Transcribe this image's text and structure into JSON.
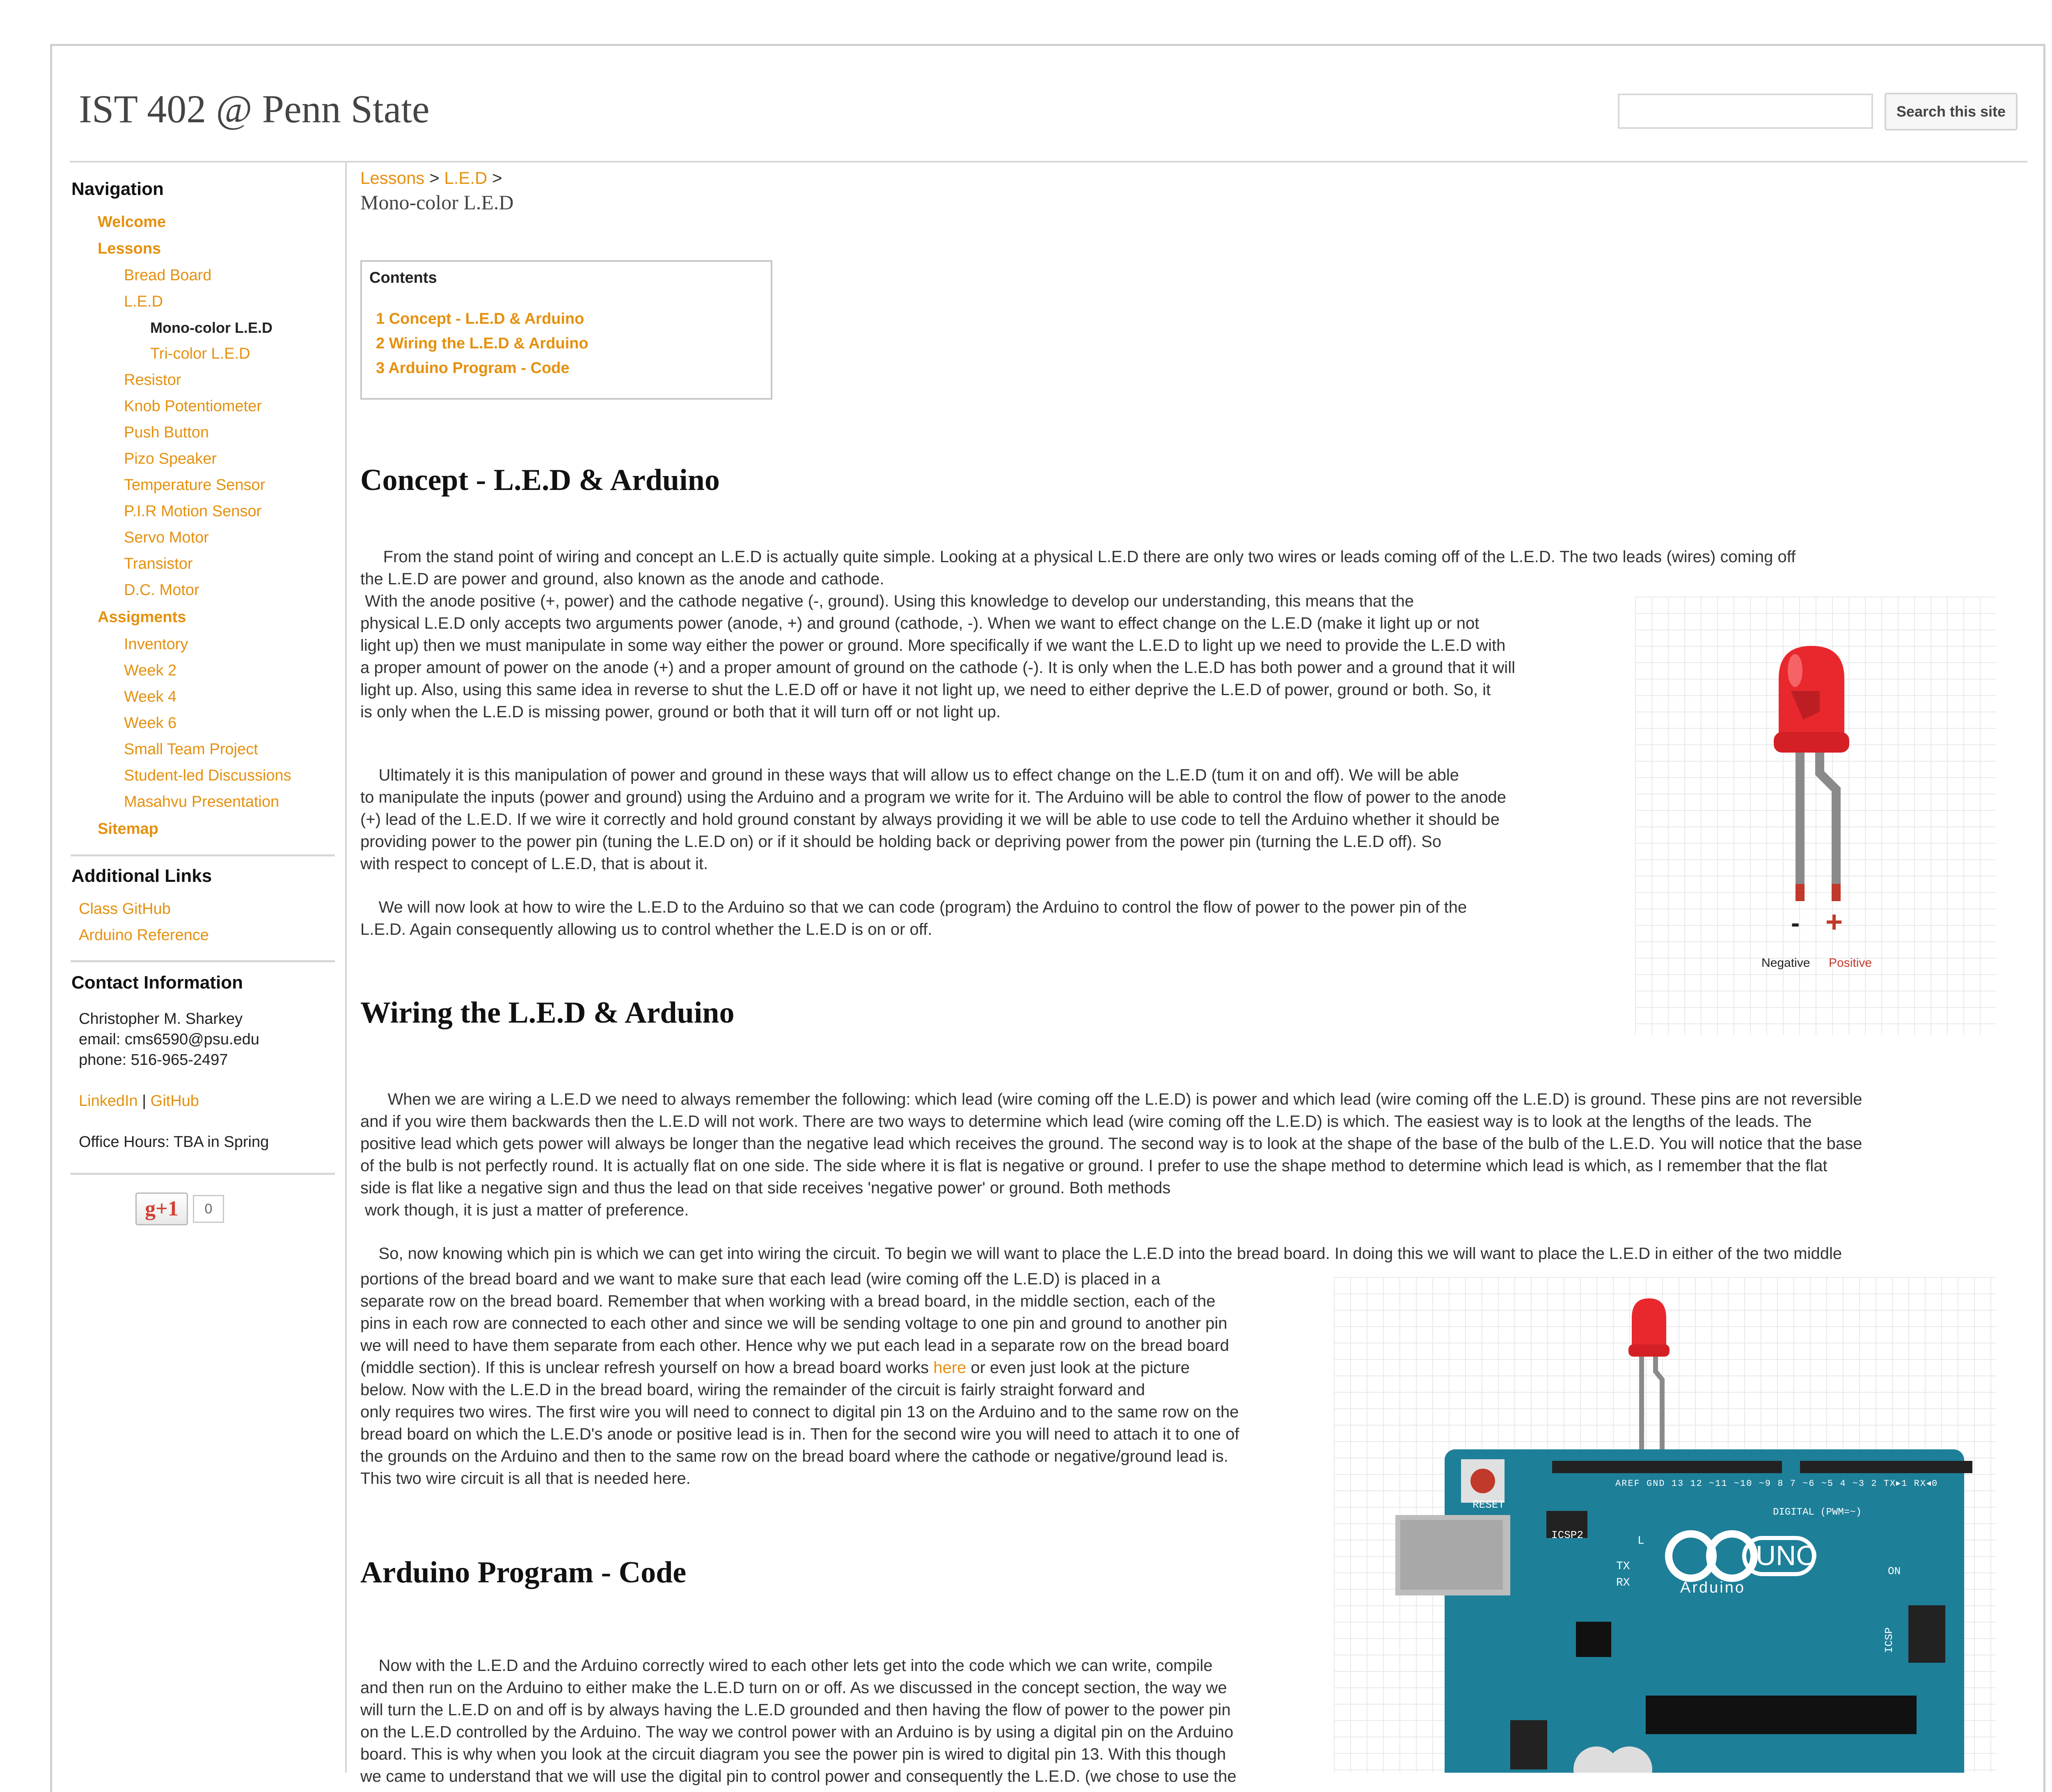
{
  "header": {
    "site_title": "IST 402 @ Penn State",
    "search_button": "Search this site",
    "search_placeholder": ""
  },
  "sidebar": {
    "nav_heading": "Navigation",
    "nav": {
      "welcome": "Welcome",
      "lessons": "Lessons",
      "bread_board": "Bread Board",
      "led": "L.E.D",
      "mono_led": "Mono-color L.E.D",
      "tri_led": "Tri-color L.E.D",
      "resistor": "Resistor",
      "knob": "Knob Potentiometer",
      "push_button": "Push Button",
      "pizo": "Pizo Speaker",
      "temp": "Temperature Sensor",
      "pir": "P.I.R Motion Sensor",
      "servo": "Servo Motor",
      "transistor": "Transistor",
      "dc_motor": "D.C. Motor",
      "assigments": "Assigments",
      "inventory": "Inventory",
      "week2": "Week 2",
      "week4": "Week 4",
      "week6": "Week 6",
      "small_team": "Small Team Project",
      "student_led": "Student-led Discussions",
      "masahvu": "Masahvu Presentation",
      "sitemap": "Sitemap"
    },
    "links_heading": "Additional Links",
    "links": {
      "github": "Class GitHub",
      "arduino_ref": "Arduino Reference"
    },
    "contact_heading": "Contact Information",
    "contact": {
      "name": "Christopher M. Sharkey",
      "email": "email: cms6590@psu.edu",
      "phone": "phone: 516-965-2497",
      "linkedin": "LinkedIn",
      "separator": " | ",
      "github": "GitHub",
      "office_hours": "Office Hours: TBA in Spring"
    },
    "gplus": {
      "label": "g+1",
      "count": "0"
    }
  },
  "main": {
    "breadcrumb": {
      "lessons": "Lessons",
      "sep1": " > ",
      "led": "L.E.D",
      "sep2": " >"
    },
    "page_title": "Mono-color L.E.D",
    "toc": {
      "title": "Contents",
      "items": [
        "1  Concept - L.E.D & Arduino",
        "2 Wiring the L.E.D & Arduino",
        "3 Arduino Program - Code"
      ]
    },
    "sections": {
      "concept": "Concept - L.E.D & Arduino",
      "wiring": "Wiring the L.E.D & Arduino",
      "code": "Arduino Program - Code"
    },
    "concept_p1": "     From the stand point of wiring and concept an L.E.D is actually quite simple. Looking at a physical L.E.D there are only two wires or leads coming off of the L.E.D. The two leads (wires) coming off\nthe L.E.D are power and ground, also known as the anode and cathode.\n With the anode positive (+, power) and the cathode negative (-, ground). Using this knowledge to develop our understanding, this means that the\nphysical L.E.D only accepts two arguments power (anode, +) and ground (cathode, -). When we want to effect change on the L.E.D (make it light up or not\nlight up) then we must manipulate in some way either the power or ground. More specifically if we want the L.E.D to light up we need to provide the L.E.D with\na proper amount of power on the anode (+) and a proper amount of ground on the cathode (-). It is only when the L.E.D has both power and a ground that it will\nlight up. Also, using this same idea in reverse to shut the L.E.D off or have it not light up, we need to either deprive the L.E.D of power, ground or both. So, it\nis only when the L.E.D is missing power, ground or both that it will turn off or not light up.",
    "concept_p2": "    Ultimately it is this manipulation of power and ground in these ways that will allow us to effect change on the L.E.D (tum it on and off). We will be able\nto manipulate the inputs (power and ground) using the Arduino and a program we write for it. The Arduino will be able to control the flow of power to the anode\n(+) lead of the L.E.D. If we wire it correctly and hold ground constant by always providing it we will be able to use code to tell the Arduino whether it should be\nproviding power to the power pin (tuning the L.E.D on) or if it should be holding back or depriving power from the power pin (turning the L.E.D off). So\nwith respect to concept of L.E.D, that is about it.",
    "concept_p3": "    We will now look at how to wire the L.E.D to the Arduino so that we can code (program) the Arduino to control the flow of power to the power pin of the\nL.E.D. Again consequently allowing us to control whether the L.E.D is on or off.",
    "wiring_p1": "      When we are wiring a L.E.D we need to always remember the following: which lead (wire coming off the L.E.D) is power and which lead (wire coming off the L.E.D) is ground. These pins are not reversible\nand if you wire them backwards then the L.E.D will not work. There are two ways to determine which lead (wire coming off the L.E.D) is which. The easiest way is to look at the lengths of the leads. The\npositive lead which gets power will always be longer than the negative lead which receives the ground. The second way is to look at the shape of the base of the bulb of the L.E.D. You will notice that the base\nof the bulb is not perfectly round. It is actually flat on one side. The side where it is flat is negative or ground. I prefer to use the shape method to determine which lead is which, as I remember that the flat\nside is flat like a negative sign and thus the lead on that side receives 'negative power' or ground. Both methods\n work though, it is just a matter of preference.",
    "wiring_p2_first": "    So, now knowing which pin is which we can get into wiring the circuit. To begin we will want to place the L.E.D into the bread board. In doing this we will want to place the L.E.D in either of the two middle",
    "wiring_p2_a": "portions of the bread board and we want to make sure that each lead (wire coming off the L.E.D) is placed in a\nseparate row on the bread board. Remember that when working with a bread board, in the middle section, each of the\npins in each row are connected to each other and since we will be sending voltage to one pin and ground to another pin\nwe will need to have them separate from each other. Hence why we put each lead in a separate row on the bread board\n(middle section). If this is unclear refresh yourself on how a bread board works ",
    "wiring_here": "here",
    "wiring_p2_b": " or even just look at the picture",
    "wiring_p2_c": "below. Now with the L.E.D in the bread board, wiring the remainder of the circuit is fairly straight forward and\nonly requires two wires. The first wire you will need to connect to digital pin 13 on the Arduino and to the same row on the\nbread board on which the L.E.D's anode or positive lead is in. Then for the second wire you will need to attach it to one of\nthe grounds on the Arduino and then to the same row on the bread board where the cathode or negative/ground lead is.\nThis two wire circuit is all that is needed here.",
    "code_p1": "    Now with the L.E.D and the Arduino correctly wired to each other lets get into the code which we can write, compile\nand then run on the Arduino to either make the L.E.D turn on or off. As we discussed in the concept section, the way we\nwill turn the L.E.D on and off is by always having the L.E.D grounded and then having the flow of power to the power pin\non the L.E.D controlled by the Arduino. The way we control power with an Arduino is by using a digital pin on the Arduino\nboard. This is why when you look at the circuit diagram you see the power pin is wired to digital pin 13. With this though\nwe came to understand that we will use the digital pin to control power and consequently the L.E.D. (we chose to use the",
    "fig_led": {
      "negative_sign": "-",
      "positive_sign": "+",
      "negative": "Negative",
      "positive": "Positive"
    },
    "fig_arduino": {
      "reset": "RESET",
      "icsp2": "ICSP2",
      "aref": "AREF",
      "gnd": "GND",
      "pins_left": [
        "13",
        "12",
        "~11",
        "~10",
        "~9",
        "8"
      ],
      "pins_right": [
        "7",
        "~6",
        "~5",
        "4",
        "~3",
        "2",
        "TX▸1",
        "RX◂0"
      ],
      "digital": "DIGITAL (PWM=~)",
      "tx": "TX",
      "rx": "RX",
      "l": "L",
      "uno": "UNO",
      "arduino": "Arduino",
      "on": "ON",
      "icsp": "ICSP"
    }
  },
  "colors": {
    "link": "#e5900e",
    "board": "#1e7f99",
    "led": "#e8282d"
  }
}
